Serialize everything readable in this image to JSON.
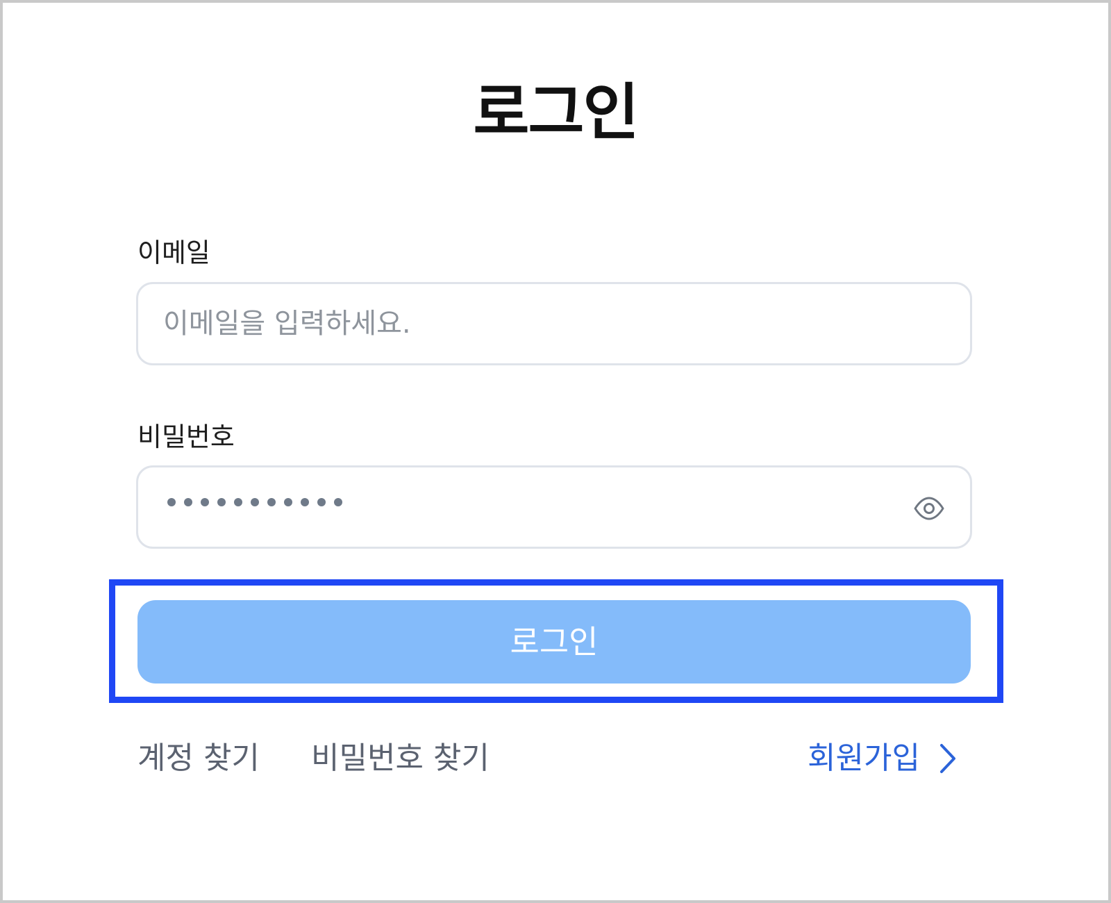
{
  "page": {
    "title": "로그인"
  },
  "form": {
    "email": {
      "label": "이메일",
      "placeholder": "이메일을 입력하세요.",
      "value": ""
    },
    "password": {
      "label": "비밀번호",
      "masked_length": 11,
      "toggle_icon": "eye-icon"
    },
    "submit_label": "로그인"
  },
  "links": {
    "find_account": "계정 찾기",
    "find_password": "비밀번호 찾기",
    "signup": "회원가입",
    "signup_icon": "chevron-right-icon"
  },
  "colors": {
    "button_bg": "#84bbfa",
    "button_text": "#ffffff",
    "highlight_border": "#1f47f5",
    "link_accent": "#2b63d9",
    "muted_text": "#5b6270"
  }
}
